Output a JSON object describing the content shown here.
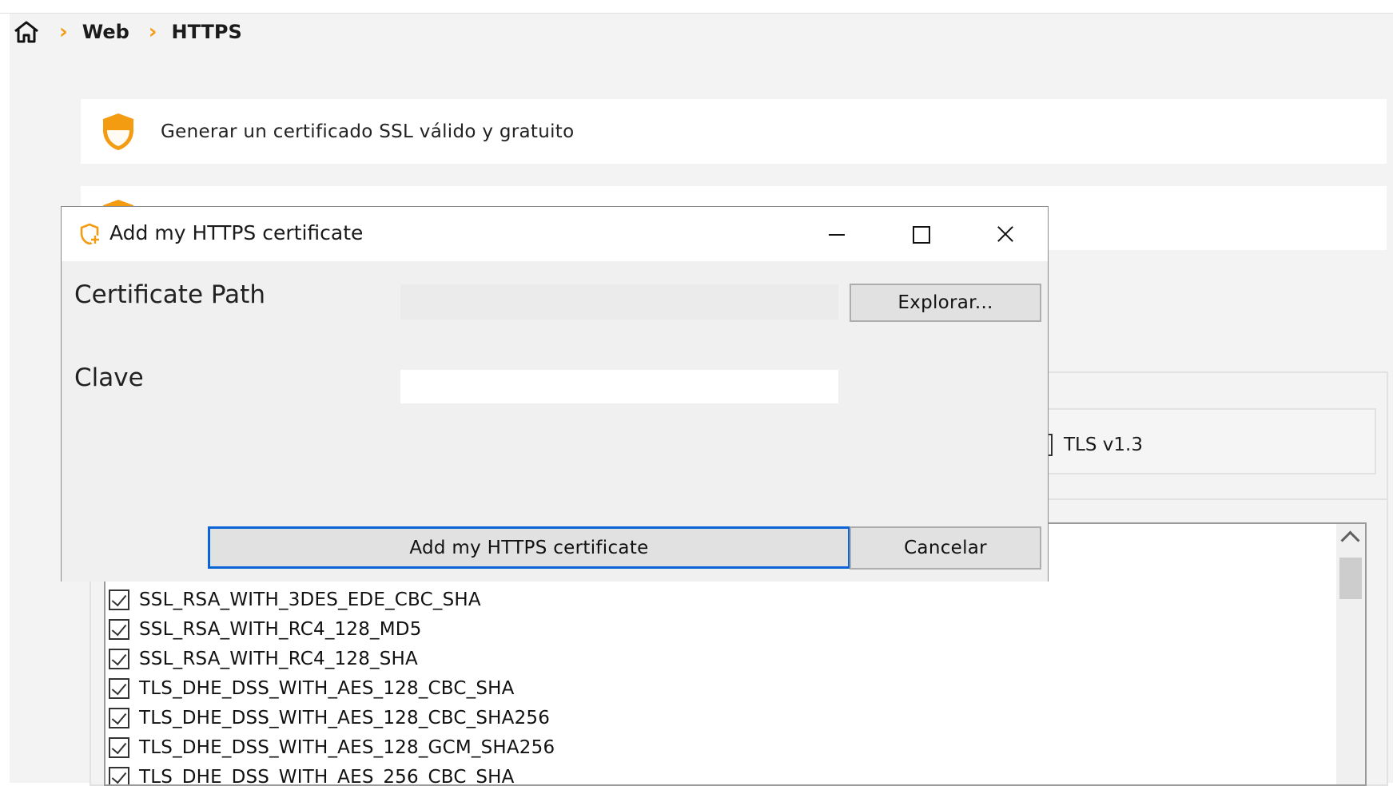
{
  "breadcrumb": {
    "items": [
      "Web",
      "HTTPS"
    ]
  },
  "cards": [
    {
      "label": "Generar un certificado SSL válido y gratuito",
      "icon": "shield-icon"
    },
    {
      "label": "",
      "icon": "shield-icon"
    }
  ],
  "tls": {
    "label": "TLS v1.3"
  },
  "ciphers": [
    "SSL_RSA_WITH_3DES_EDE_CBC_SHA",
    "SSL_RSA_WITH_RC4_128_MD5",
    "SSL_RSA_WITH_RC4_128_SHA",
    "TLS_DHE_DSS_WITH_AES_128_CBC_SHA",
    "TLS_DHE_DSS_WITH_AES_128_CBC_SHA256",
    "TLS_DHE_DSS_WITH_AES_128_GCM_SHA256",
    "TLS_DHE_DSS_WITH_AES_256_CBC_SHA"
  ],
  "dialog": {
    "title": "Add my HTTPS certificate",
    "path_label": "Certificate Path",
    "path_value": "",
    "key_label": "Clave",
    "key_value": "",
    "browse_label": "Explorar...",
    "add_label": "Add my HTTPS certificate",
    "cancel_label": "Cancelar"
  },
  "colors": {
    "accent": "#f39c12",
    "focus": "#0a64d6"
  }
}
